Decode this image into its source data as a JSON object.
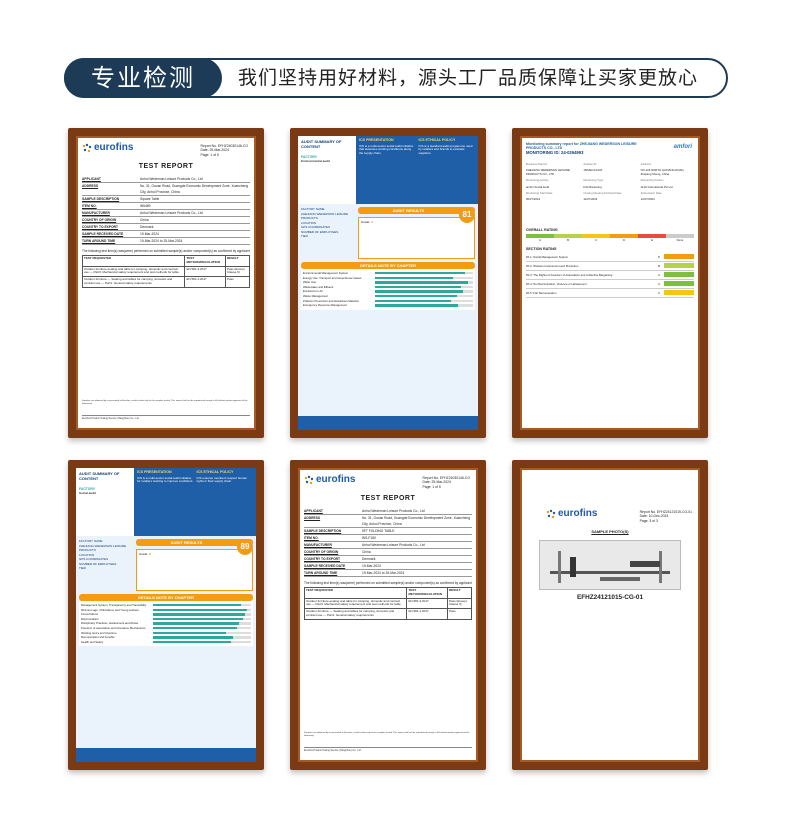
{
  "header": {
    "tag": "专业检测",
    "slogan": "我们坚持用好材料，源头工厂品质保障让买家更放心"
  },
  "eurofins1": {
    "logo": "eurofins",
    "meta": [
      "Report No.   EFHZ24030146-CG",
      "Date: 25-Mar-2024",
      "Page:  1  of 5"
    ],
    "title": "TEST REPORT",
    "fields": [
      {
        "k": "APPLICANT",
        "v": "Anhui Wedernan Leisure Products Co., Ltd"
      },
      {
        "k": "ADDRESS",
        "v": "No. 31, Guzan Road, Guangde Economic Development Zone, Xuancheng City, Anhui Province, China"
      },
      {
        "k": "SAMPLE DESCRIPTION",
        "v": "Square Table"
      },
      {
        "k": "ITEM NO.",
        "v": "W5489"
      },
      {
        "k": "MANUFACTURER",
        "v": "Anhui Wedernan Leisure Products Co., Ltd"
      },
      {
        "k": "COUNTRY OF ORIGIN",
        "v": "China"
      },
      {
        "k": "COUNTRY TO EXPORT",
        "v": "Denmark"
      },
      {
        "k": "SAMPLE RECEIVED DATE",
        "v": "19-Mar-2024"
      },
      {
        "k": "TURN AROUND TIME",
        "v": "19-Mar-2024 to 25-Mar-2024"
      }
    ],
    "note": "The following test item(s) was(were) performed on submitted sample(s) and/or component(s) as confirmed by applicant",
    "table_head": [
      "TEST REQUESTED",
      "TEST METHOD/REGULATION",
      "RESULT"
    ],
    "rows": [
      [
        "Outdoor furniture-seating and table for camping, domestic and contract use — Part3: Mechanical safety requirement and test methods for table",
        "EN 581-3:2017",
        "Pass (Except Clause 6)"
      ],
      [
        "Outdoor furniture — Seating and tables for camping, domestic and contract use — Part1: General safety requirements",
        "EN 581-1:2017",
        "Pass"
      ]
    ],
    "smallprint": "Samples are obtained by or presented to Eurofins; results relate only to the samples tested. This report shall not be reproduced except in full without written approval of the laboratory.",
    "footer": "Eurofins Product Testing Service (Hangzhou) Co., Ltd"
  },
  "bsci1": {
    "left_title": "AUDIT SUMMARY OF CONTENT",
    "col1_title": "ICS PRESENTATION",
    "col1_text": "ICS is a multi-sector social audit initiative that assesses working conditions along the supply chain.",
    "col2_title": "ICS ETHICAL POLICY",
    "col2_text": "ICS is a standard audit programme used by retailers and brands to evaluate suppliers.",
    "factory_label": "FACTORY",
    "factory_type": "Environmental audit",
    "side": [
      "FACTORY NAME",
      "ZHEJIANG WEDERSON LEISURE PRODUCTS",
      "LOCATION",
      "GPS COORDINATES",
      "NUMBER OF EMPLOYEES",
      "TIER"
    ],
    "results": "AUDIT RESULTS",
    "grade": "C",
    "score": "81",
    "chapters_title": "DETAILS NOTE BY CHAPTER",
    "chapters": [
      {
        "name": "Environmental Management System",
        "pct": 92
      },
      {
        "name": "Energy Use, Transport and Greenhouse Gases",
        "pct": 80
      },
      {
        "name": "Water Use",
        "pct": 95
      },
      {
        "name": "Wastewater and Effluent",
        "pct": 88
      },
      {
        "name": "Emissions to Air",
        "pct": 90
      },
      {
        "name": "Waste Management",
        "pct": 84
      },
      {
        "name": "Pollution Prevention and Hazardous Material",
        "pct": 78
      },
      {
        "name": "Emergency Resource Management",
        "pct": 85
      }
    ]
  },
  "amfori": {
    "head1": "Monitoring summary report for ZHEJIANG WEDERSON LEISURE PRODUCTS CO., LTD",
    "head2": "MONITORING ID: 24-0264993",
    "logo": "amfori",
    "grid": [
      "Business Partner",
      "Auditee ID",
      "Address",
      "ZHEJIANG WEDERSON LEISURE PRODUCTS CO., LTD",
      "156492-04-001",
      "NO.103 NORTH QUXIANG ROAD, Zhejiang Sheng, China",
      "Monitoring Activity",
      "Monitoring Type",
      "Monitoring Partner",
      "amfori Social Audit",
      "Full Monitoring",
      "ALDI International Pvt Ltd",
      "Monitoring Start Date",
      "Closing Meeting Finished Date",
      "Submission Date",
      "05/27/2024",
      "12/27/2024",
      "12/27/2024"
    ],
    "overall": "OVERALL RATING",
    "scale": [
      "A",
      "B",
      "C",
      "D",
      "E",
      "None"
    ],
    "section": "SECTION RATING",
    "sections": [
      {
        "name": "PA 1: Social Management System",
        "grade": "D"
      },
      {
        "name": "PA 2: Workers Involvement and Protection",
        "grade": "B"
      },
      {
        "name": "PA 3: The Rights of Freedom of Association and Collective Bargaining",
        "grade": "A"
      },
      {
        "name": "PA 4: No Discrimination, Violence or Harassment",
        "grade": "A"
      },
      {
        "name": "PA 5: Fair Remuneration",
        "grade": "C"
      }
    ]
  },
  "bsci2": {
    "left_title": "AUDIT SUMMARY OF CONTENT",
    "col1_title": "ICS PRESENTATION",
    "col1_text": "ICS is a multi-sector social audit initiative for retailers working to improve conditions.",
    "col2_title": "ICS ETHICAL POLICY",
    "col2_text": "ICS ensures members respect human rights in their supply chain.",
    "factory_label": "FACTORY",
    "factory_type": "Social audit",
    "side": [
      "FACTORY NAME",
      "ZHEJIANG WEDERSON LEISURE PRODUCTS",
      "LOCATION",
      "GPS COORDINATES",
      "NUMBER OF EMPLOYEES",
      "TIER"
    ],
    "results": "AUDIT RESULTS",
    "grade": "B",
    "score": "89",
    "chapters_title": "DETAILS NOTE BY CHAPTER",
    "chapters": [
      {
        "name": "Management System, Transparency and Traceability",
        "pct": 90
      },
      {
        "name": "Minimum age, Child labour and Young workers",
        "pct": 96
      },
      {
        "name": "Forced labour",
        "pct": 94
      },
      {
        "name": "Discrimination",
        "pct": 92
      },
      {
        "name": "Disciplinary Practices, Harassment and Abuse",
        "pct": 88
      },
      {
        "name": "Freedom of association and Grievance Mechanisms",
        "pct": 86
      },
      {
        "name": "Working hours and Overtime",
        "pct": 74
      },
      {
        "name": "Remuneration and benefits",
        "pct": 82
      },
      {
        "name": "Health and Safety",
        "pct": 80
      }
    ]
  },
  "eurofins2": {
    "logo": "eurofins",
    "meta": [
      "Report No.   EFHZ24030146-CG",
      "Date: 25-Mar-2024",
      "Page:  1  of 5"
    ],
    "title": "TEST REPORT",
    "fields": [
      {
        "k": "APPLICANT",
        "v": "Anhui Wedernan Leisure Products Co., Ltd"
      },
      {
        "k": "ADDRESS",
        "v": "No. 31, Guzan Road, Guangde Economic Development Zone, Xuancheng City, Anhui Province, China"
      },
      {
        "k": "SAMPLE DESCRIPTION",
        "v": "5FT FOLDING TABLE"
      },
      {
        "k": "ITEM NO.",
        "v": "WS-F180"
      },
      {
        "k": "MANUFACTURER",
        "v": "Anhui Wedernan Leisure Products Co., Ltd"
      },
      {
        "k": "COUNTRY OF ORIGIN",
        "v": "China"
      },
      {
        "k": "COUNTRY TO EXPORT",
        "v": "Denmark"
      },
      {
        "k": "SAMPLE RECEIVED DATE",
        "v": "19-Mar-2024"
      },
      {
        "k": "TURN AROUND TIME",
        "v": "19-Mar-2024 to 25-Mar-2024"
      }
    ],
    "note": "The following test item(s) was(were) performed on submitted sample(s) and/or component(s) as confirmed by applicant",
    "table_head": [
      "TEST REQUESTED",
      "TEST METHOD/REGULATION",
      "RESULT"
    ],
    "rows": [
      [
        "Outdoor furniture-seating and table for camping, domestic and contract use — Part3: Mechanical safety requirement and test methods for table",
        "EN 581-3:2017",
        "Pass (Except Clause 6)"
      ],
      [
        "Outdoor furniture — Seating and tables for camping, domestic and contract use — Part1: General safety requirements",
        "EN 581-1:2017",
        "Pass"
      ]
    ],
    "smallprint": "Samples are obtained by or presented to Eurofins; results relate only to the samples tested. This report shall not be reproduced except in full without written approval of the laboratory.",
    "footer": "Eurofins Product Testing Service (Hangzhou) Co., Ltd"
  },
  "photo": {
    "logo": "eurofins",
    "meta": [
      "Report No.  EFHZ24121015-CG-01",
      "Date: 10-Dec-2024",
      "Page: 3 of 3"
    ],
    "title": "SAMPLE PHOTO(S)",
    "caption": "EFHZ24121015-CG-01"
  }
}
